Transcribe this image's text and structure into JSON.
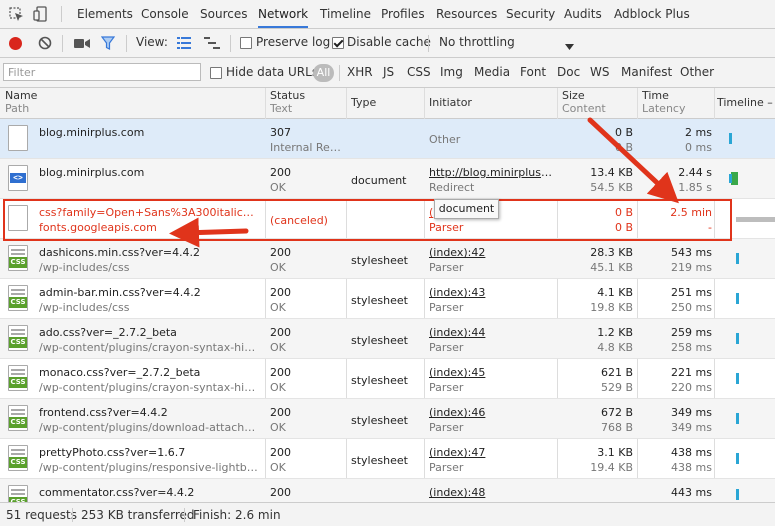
{
  "tabs": [
    {
      "label": "Elements"
    },
    {
      "label": "Console"
    },
    {
      "label": "Sources"
    },
    {
      "label": "Network"
    },
    {
      "label": "Timeline"
    },
    {
      "label": "Profiles"
    },
    {
      "label": "Resources"
    },
    {
      "label": "Security"
    },
    {
      "label": "Audits"
    },
    {
      "label": "Adblock Plus"
    }
  ],
  "toolbar": {
    "view_label": "View:",
    "preserve_log": {
      "label": "Preserve log",
      "checked": false
    },
    "disable_cache": {
      "label": "Disable cache",
      "checked": true
    },
    "throttling": "No throttling"
  },
  "filter": {
    "placeholder": "Filter",
    "hide_data_urls": "Hide data URLs",
    "all": "All",
    "types": [
      "XHR",
      "JS",
      "CSS",
      "Img",
      "Media",
      "Font",
      "Doc",
      "WS",
      "Manifest",
      "Other"
    ]
  },
  "columns": {
    "name": "Name",
    "path": "Path",
    "status": "Status",
    "text": "Text",
    "type": "Type",
    "initiator": "Initiator",
    "size": "Size",
    "content": "Content",
    "time": "Time",
    "latency": "Latency",
    "timeline": "Timeline – S"
  },
  "rows": [
    {
      "name": "blog.minirplus.com",
      "path": "",
      "status": "307",
      "status_text": "Internal Redi...",
      "type": "",
      "initiator": "Other",
      "initiator_sub": "",
      "size": "0 B",
      "content": "0 B",
      "time": "2 ms",
      "latency": "0 ms",
      "icon": "file-icon"
    },
    {
      "name": "blog.minirplus.com",
      "path": "",
      "status": "200",
      "status_text": "OK",
      "type": "document",
      "initiator": "http://blog.minirplus.co...",
      "initiator_sub": "Redirect",
      "size": "13.4 KB",
      "content": "54.5 KB",
      "time": "2.44 s",
      "latency": "1.85 s",
      "icon": "html-document-icon"
    },
    {
      "name": "css?family=Open+Sans%3A300italic%2C400...",
      "path": "fonts.googleapis.com",
      "status": "(canceled)",
      "status_text": "",
      "type": "",
      "initiator": "(",
      "initiator_sub": "Parser",
      "size": "0 B",
      "content": "0 B",
      "time": "2.5 min",
      "latency": "-",
      "icon": "file-icon"
    },
    {
      "name": "dashicons.min.css?ver=4.4.2",
      "path": "/wp-includes/css",
      "status": "200",
      "status_text": "OK",
      "type": "stylesheet",
      "initiator": "(index):42",
      "initiator_sub": "Parser",
      "size": "28.3 KB",
      "content": "45.1 KB",
      "time": "543 ms",
      "latency": "219 ms",
      "icon": "css-file-icon"
    },
    {
      "name": "admin-bar.min.css?ver=4.4.2",
      "path": "/wp-includes/css",
      "status": "200",
      "status_text": "OK",
      "type": "stylesheet",
      "initiator": "(index):43",
      "initiator_sub": "Parser",
      "size": "4.1 KB",
      "content": "19.8 KB",
      "time": "251 ms",
      "latency": "250 ms",
      "icon": "css-file-icon"
    },
    {
      "name": "ado.css?ver=_2.7.2_beta",
      "path": "/wp-content/plugins/crayon-syntax-highligh...",
      "status": "200",
      "status_text": "OK",
      "type": "stylesheet",
      "initiator": "(index):44",
      "initiator_sub": "Parser",
      "size": "1.2 KB",
      "content": "4.8 KB",
      "time": "259 ms",
      "latency": "258 ms",
      "icon": "css-file-icon"
    },
    {
      "name": "monaco.css?ver=_2.7.2_beta",
      "path": "/wp-content/plugins/crayon-syntax-highligh...",
      "status": "200",
      "status_text": "OK",
      "type": "stylesheet",
      "initiator": "(index):45",
      "initiator_sub": "Parser",
      "size": "621 B",
      "content": "529 B",
      "time": "221 ms",
      "latency": "220 ms",
      "icon": "css-file-icon"
    },
    {
      "name": "frontend.css?ver=4.4.2",
      "path": "/wp-content/plugins/download-attachment...",
      "status": "200",
      "status_text": "OK",
      "type": "stylesheet",
      "initiator": "(index):46",
      "initiator_sub": "Parser",
      "size": "672 B",
      "content": "768 B",
      "time": "349 ms",
      "latency": "349 ms",
      "icon": "css-file-icon"
    },
    {
      "name": "prettyPhoto.css?ver=1.6.7",
      "path": "/wp-content/plugins/responsive-lightbox/as...",
      "status": "200",
      "status_text": "OK",
      "type": "stylesheet",
      "initiator": "(index):47",
      "initiator_sub": "Parser",
      "size": "3.1 KB",
      "content": "19.4 KB",
      "time": "438 ms",
      "latency": "438 ms",
      "icon": "css-file-icon"
    },
    {
      "name": "commentator.css?ver=4.4.2",
      "path": "",
      "status": "200",
      "status_text": "",
      "type": "",
      "initiator": "(index):48",
      "initiator_sub": "",
      "size": "",
      "content": "",
      "time": "443 ms",
      "latency": "",
      "icon": "css-file-icon"
    }
  ],
  "tooltip": "document",
  "status": {
    "requests": "51 requests",
    "transferred": "253 KB transferred",
    "finish": "Finish: 2.6 min"
  },
  "colors": {
    "accent": "#3879d9",
    "error": "#e0341b",
    "record": "#d9261c",
    "selection": "#deebf9",
    "timeline": "#2aa6d5"
  }
}
